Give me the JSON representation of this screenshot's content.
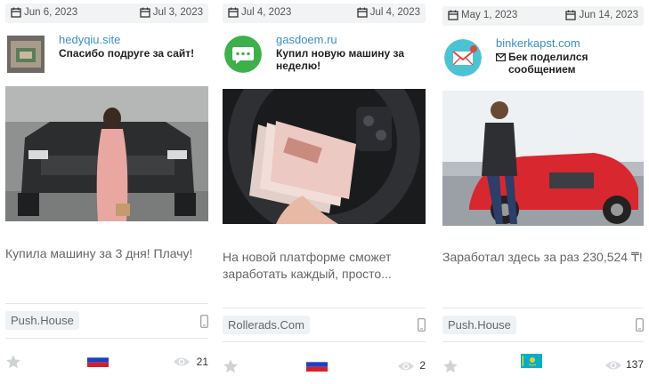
{
  "cards": [
    {
      "date_start": "Jun 6, 2023",
      "date_end": "Jul 3, 2023",
      "site": "hedyqiu.site",
      "title": "Спасибо подруге за сайт!",
      "description": "Купила машину за 3 дня! Плачу!",
      "network": "Push.House",
      "views": "21",
      "country_flag": "ru",
      "avatar_icon": "photo-avatar"
    },
    {
      "date_start": "Jul 4, 2023",
      "date_end": "Jul 4, 2023",
      "site": "gasdoem.ru",
      "title": "Купил новую машину за неделю!",
      "description": "На новой платформе сможет заработать каждый, просто...",
      "network": "Rollerads.Com",
      "views": "2",
      "country_flag": "ru",
      "avatar_icon": "chat-bubble-icon"
    },
    {
      "date_start": "May 1, 2023",
      "date_end": "Jun 14, 2023",
      "site": "binkerkapst.com",
      "title": "Бек поделился сообщением",
      "description": "Заработал здесь за раз 230,524 ₸!",
      "network": "Push.House",
      "views": "137",
      "country_flag": "kz",
      "avatar_icon": "mail-icon"
    }
  ]
}
